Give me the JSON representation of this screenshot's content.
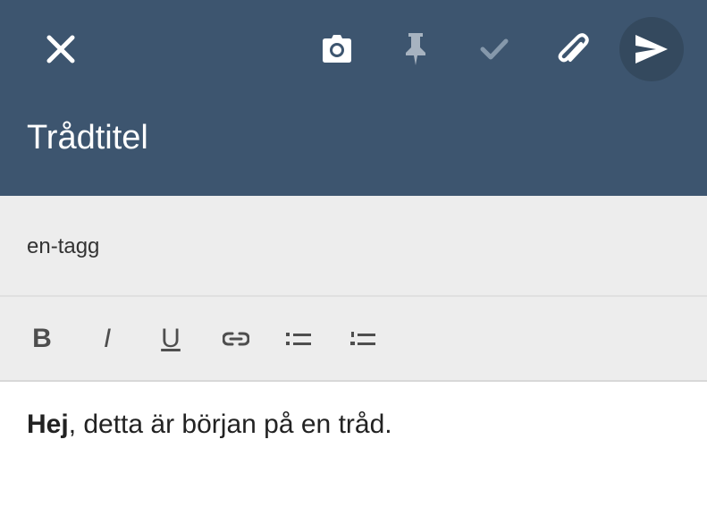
{
  "header": {
    "title": "Trådtitel",
    "background_color": "#3d556f",
    "send_button_color": "#34495e",
    "icons": {
      "close": "close-icon",
      "camera": "camera-icon",
      "pin": "pin-icon",
      "check": "check-icon",
      "attach": "paperclip-icon",
      "send": "send-icon"
    }
  },
  "tags": {
    "value": "en-tagg"
  },
  "toolbar": {
    "bold_label": "B",
    "italic_label": "I",
    "underline_label": "U",
    "icons": [
      "link-icon",
      "bulleted-list-icon",
      "numbered-list-icon"
    ]
  },
  "editor": {
    "bold_text": "Hej",
    "body_text": ", detta är början på en tråd."
  }
}
